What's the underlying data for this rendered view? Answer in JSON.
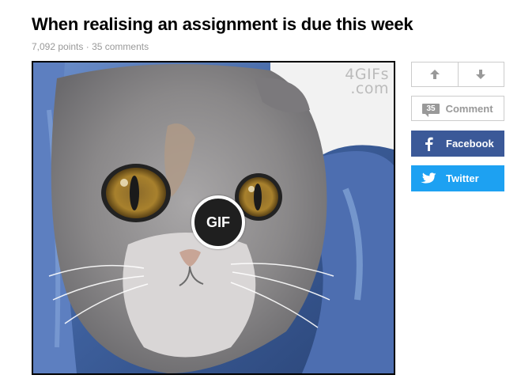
{
  "post": {
    "title": "When realising an assignment is due this week",
    "points": "7,092 points",
    "separator": " · ",
    "comments": "35 comments"
  },
  "media": {
    "watermark_line1": "4GIFs",
    "watermark_line2": ".com",
    "badge": "GIF"
  },
  "actions": {
    "upvote_icon": "arrow-up-icon",
    "downvote_icon": "arrow-down-icon",
    "comment_count": "35",
    "comment_label": "Comment",
    "facebook_label": "Facebook",
    "twitter_label": "Twitter"
  },
  "colors": {
    "facebook": "#3b5998",
    "twitter": "#1da1f2",
    "muted": "#999999"
  }
}
